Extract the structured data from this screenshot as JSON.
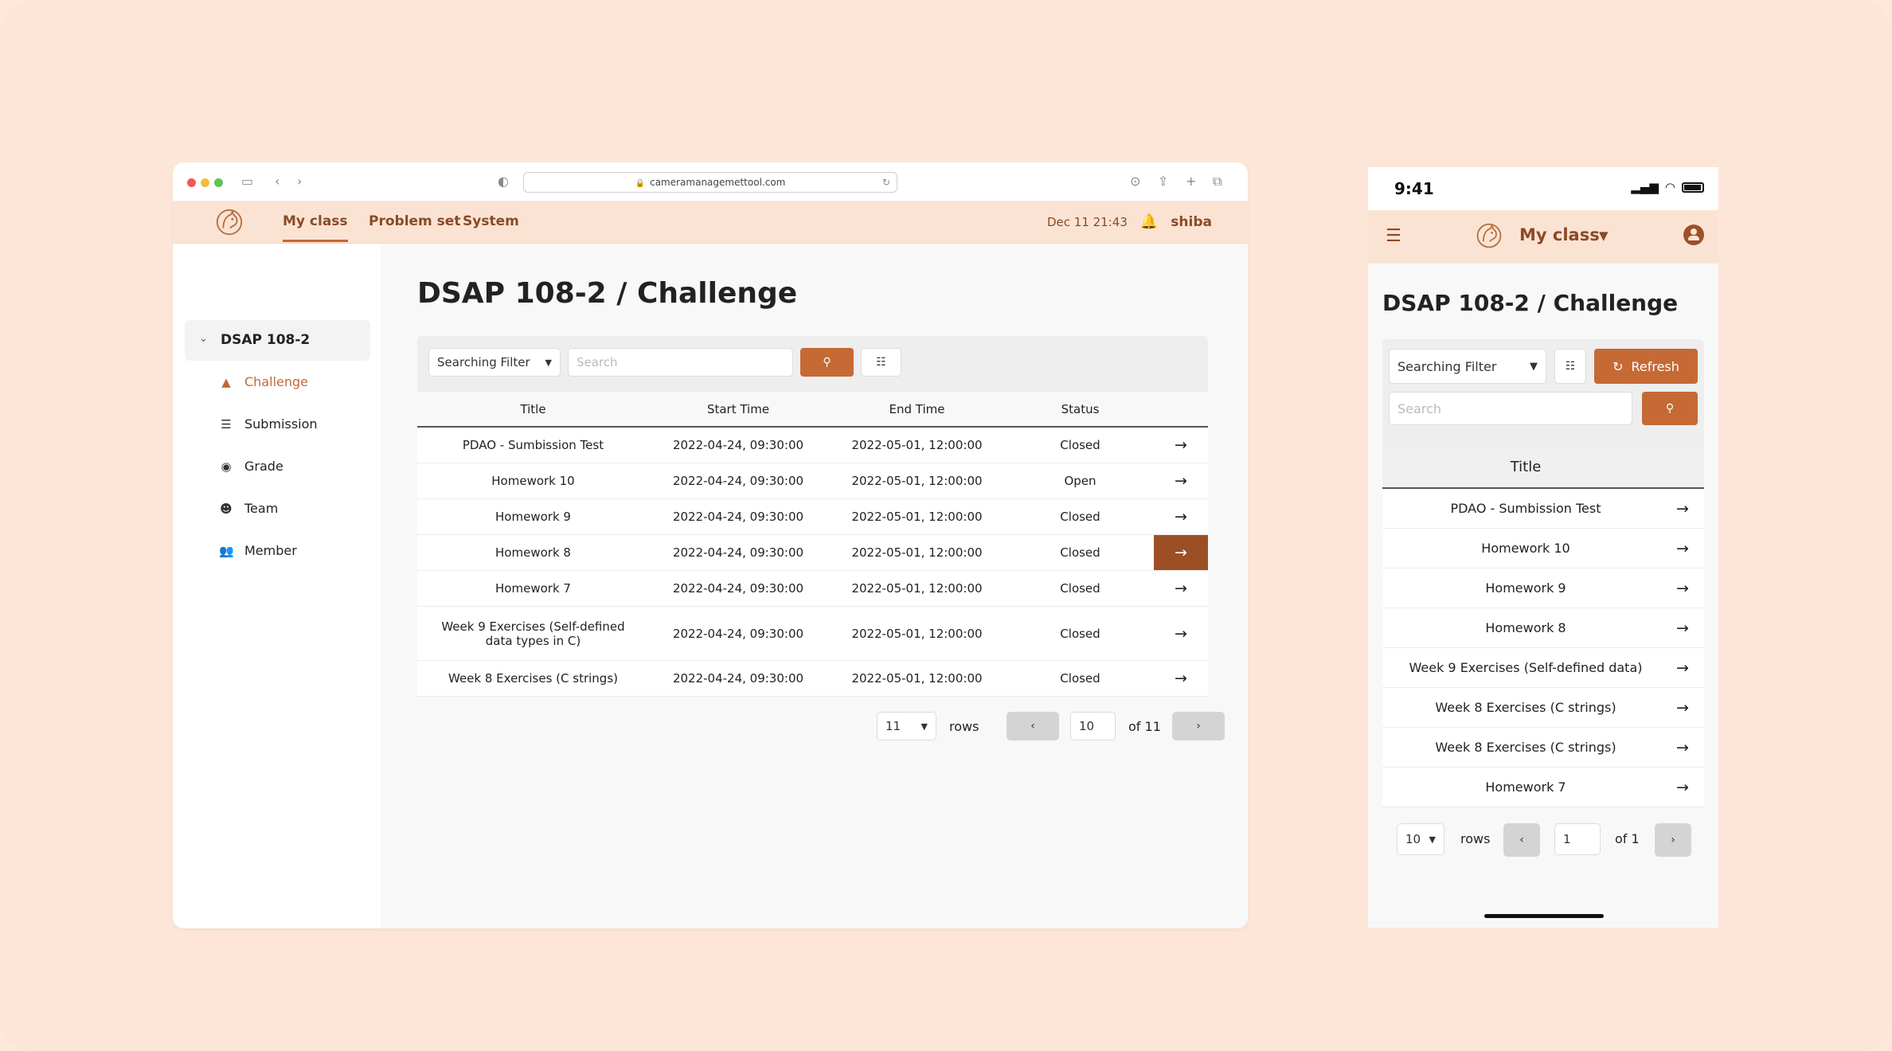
{
  "desktop": {
    "browser": {
      "url": "cameramanagemettool.com"
    },
    "nav": {
      "tabs": [
        "My class",
        "Problem set",
        "System"
      ],
      "datetime": "Dec 11  21:43",
      "username": "shiba"
    },
    "sidebar": {
      "group": "DSAP 108-2",
      "items": [
        {
          "label": "Challenge",
          "icon": "shapes-icon"
        },
        {
          "label": "Submission",
          "icon": "list-icon"
        },
        {
          "label": "Grade",
          "icon": "grade-icon"
        },
        {
          "label": "Team",
          "icon": "team-icon"
        },
        {
          "label": "Member",
          "icon": "people-icon"
        }
      ]
    },
    "page_title": "DSAP 108-2 / Challenge",
    "toolbar": {
      "filter_label": "Searching Filter",
      "search_placeholder": "Search"
    },
    "table": {
      "columns": [
        "Title",
        "Start Time",
        "End Time",
        "Status"
      ],
      "rows": [
        {
          "title": "PDAO - Sumbission Test",
          "start": "2022-04-24, 09:30:00",
          "end": "2022-05-01, 12:00:00",
          "status": "Closed"
        },
        {
          "title": "Homework 10",
          "start": "2022-04-24, 09:30:00",
          "end": "2022-05-01, 12:00:00",
          "status": "Open"
        },
        {
          "title": "Homework 9",
          "start": "2022-04-24, 09:30:00",
          "end": "2022-05-01, 12:00:00",
          "status": "Closed"
        },
        {
          "title": "Homework 8",
          "start": "2022-04-24, 09:30:00",
          "end": "2022-05-01, 12:00:00",
          "status": "Closed"
        },
        {
          "title": "Homework 7",
          "start": "2022-04-24, 09:30:00",
          "end": "2022-05-01, 12:00:00",
          "status": "Closed"
        },
        {
          "title": "Week 9 Exercises (Self-defined data types in C)",
          "start": "2022-04-24, 09:30:00",
          "end": "2022-05-01, 12:00:00",
          "status": "Closed"
        },
        {
          "title": "Week 8 Exercises (C strings)",
          "start": "2022-04-24, 09:30:00",
          "end": "2022-05-01, 12:00:00",
          "status": "Closed"
        }
      ]
    },
    "pagination": {
      "rows_value": "11",
      "rows_label": "rows",
      "page_value": "10",
      "of_label": "of 11"
    }
  },
  "mobile": {
    "status_time": "9:41",
    "nav_title": "My class",
    "page_title": "DSAP 108-2 / Challenge",
    "toolbar": {
      "filter_label": "Searching Filter",
      "refresh_label": "Refresh",
      "search_placeholder": "Search"
    },
    "table": {
      "column": "Title",
      "rows": [
        "PDAO - Sumbission Test",
        "Homework 10",
        "Homework 9",
        "Homework 8",
        "Week 9 Exercises (Self-defined data)",
        "Week 8 Exercises (C strings)",
        "Week 8 Exercises (C strings)",
        "Homework 7"
      ]
    },
    "pagination": {
      "rows_value": "10",
      "rows_label": "rows",
      "page_value": "1",
      "of_label": "of 1"
    }
  },
  "colors": {
    "background": "#fde6d7",
    "nav_bg": "#fbe3d3",
    "accent": "#c56a34",
    "accent_dark": "#9c4f24",
    "nav_text": "#8a4a26"
  }
}
